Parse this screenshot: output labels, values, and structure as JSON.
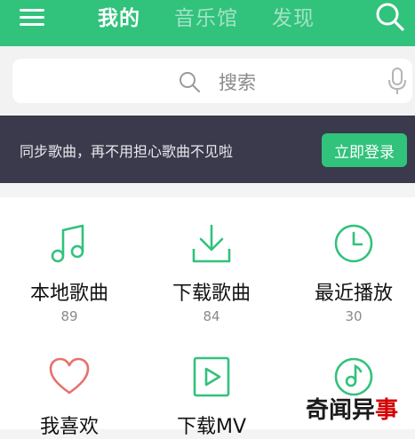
{
  "colors": {
    "brand_green": "#31c27c",
    "banner_bg": "#3a3a4c",
    "heart_red": "#e8706c"
  },
  "header": {
    "menu_icon": "hamburger-icon",
    "tabs": [
      {
        "label": "我的",
        "active": true
      },
      {
        "label": "音乐馆",
        "active": false
      },
      {
        "label": "发现",
        "active": false
      }
    ],
    "search_icon": "search-icon"
  },
  "search": {
    "placeholder": "搜索",
    "icon": "magnifier-icon",
    "voice_icon": "microphone-icon"
  },
  "banner": {
    "message": "同步歌曲，再不用担心歌曲不见啦",
    "button": "立即登录"
  },
  "grid": [
    {
      "label": "本地歌曲",
      "count": "89",
      "icon": "music-note-icon"
    },
    {
      "label": "下载歌曲",
      "count": "84",
      "icon": "download-icon"
    },
    {
      "label": "最近播放",
      "count": "30",
      "icon": "clock-icon"
    },
    {
      "label": "我喜欢",
      "icon": "heart-icon"
    },
    {
      "label": "下载MV",
      "icon": "play-video-icon"
    },
    {
      "label": "",
      "icon": "disc-note-icon"
    }
  ],
  "watermark": {
    "part1": "奇闻异",
    "part2": "事"
  }
}
